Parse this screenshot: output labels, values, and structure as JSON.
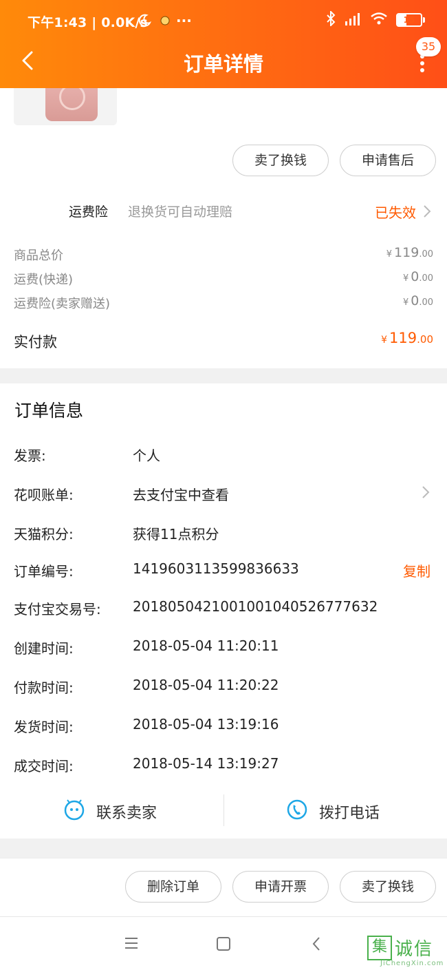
{
  "status_bar": {
    "text": "下午1:43 | 0.0K/s",
    "battery": "15"
  },
  "header": {
    "title": "订单详情",
    "badge_count": "35"
  },
  "actions_top": {
    "sell": "卖了换钱",
    "after_sale": "申请售后"
  },
  "insurance": {
    "label": "运费险",
    "desc": "退换货可自动理赔",
    "status": "已失效"
  },
  "prices": [
    {
      "label": "商品总价",
      "currency": "¥",
      "int": "119",
      "dec": ".00"
    },
    {
      "label": "运费(快递)",
      "currency": "¥",
      "int": "0",
      "dec": ".00"
    },
    {
      "label": "运费险(卖家赠送)",
      "currency": "¥",
      "int": "0",
      "dec": ".00"
    }
  ],
  "total": {
    "label": "实付款",
    "currency": "¥",
    "int": "119",
    "dec": ".00"
  },
  "order_info": {
    "title": "订单信息",
    "rows": [
      {
        "label": "发票:",
        "value": "个人"
      },
      {
        "label": "花呗账单:",
        "value": "去支付宝中查看"
      },
      {
        "label": "天猫积分:",
        "value": "获得11点积分"
      },
      {
        "label": "订单编号:",
        "value": "1419603113599836633"
      },
      {
        "label": "支付宝交易号:",
        "value": "2018050421001001040526777632"
      },
      {
        "label": "创建时间:",
        "value": "2018-05-04 11:20:11"
      },
      {
        "label": "付款时间:",
        "value": "2018-05-04 11:20:22"
      },
      {
        "label": "发货时间:",
        "value": "2018-05-04 13:19:16"
      },
      {
        "label": "成交时间:",
        "value": "2018-05-14 13:19:27"
      }
    ],
    "copy_label": "复制"
  },
  "contact": {
    "seller": "联系卖家",
    "call": "拨打电话"
  },
  "bottom_actions": {
    "delete": "删除订单",
    "invoice": "申请开票",
    "sell": "卖了换钱"
  },
  "watermark": {
    "box": "集",
    "text": "诚信",
    "sub": "JiChengXin.com"
  },
  "colors": {
    "accent": "#ff5a00",
    "header_start": "#ff8a0a",
    "header_end": "#ff4f17"
  }
}
